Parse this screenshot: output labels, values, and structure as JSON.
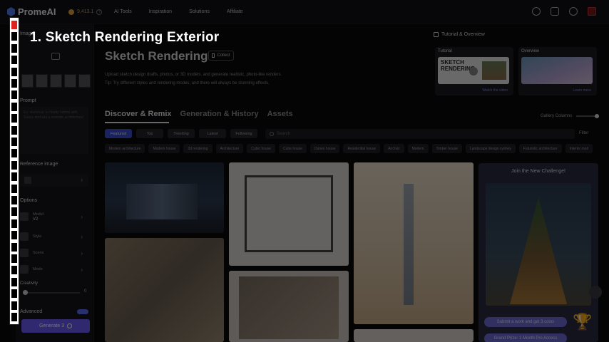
{
  "overlay": {
    "caption": "1. Sketch Rendering Exterior"
  },
  "nav": {
    "logo": "PromeAI",
    "coins": "9,413.1",
    "links": [
      "AI Tools",
      "Inspiration",
      "Solutions",
      "Affiliate"
    ]
  },
  "left_panel": {
    "image_title": "Image",
    "prompt_title": "Prompt",
    "prompt_placeholder": "Ex: sketchup 'a cloudy harbor with Sanny and sea a seaside architecture'",
    "reference_title": "Reference image",
    "options_title": "Options",
    "model_label": "Model",
    "model_value": "V2",
    "style_label": "Style",
    "scene_label": "Scene",
    "mode_label": "Mode",
    "creativity_label": "Creativity",
    "creativity_value": "0",
    "advanced_label": "Advanced",
    "generate_label": "Generate 3"
  },
  "main": {
    "title": "Sketch Rendering",
    "collect_label": "Collect",
    "desc_line1": "Upload sketch design drafts, photos, or 3D models, and generate realistic, photo-like renders.",
    "desc_line2": "Tip: Try different styles and rendering modes, and there will always be stunning effects.",
    "tutorial_header": "Tutorial & Overview",
    "tutorial_card": {
      "title": "Tutorial",
      "thumb_text": "SKETCH RENDERING",
      "link": "Watch the video"
    },
    "overview_card": {
      "title": "Overview",
      "link": "Learn more"
    },
    "tabs": [
      "Discover & Remix",
      "Generation & History",
      "Assets"
    ],
    "gallery_columns_label": "Gallery Columns",
    "filters": [
      "Featured",
      "Top",
      "Trending",
      "Latest",
      "Following"
    ],
    "search_placeholder": "Search",
    "filter_label": "Filter",
    "chips": [
      "Modern architecture",
      "Modern house",
      "3d rendering",
      "Architecture",
      "Cubic house",
      "Cube house",
      "Dunes house",
      "Residential house",
      "Archviz",
      "Modern",
      "Timber house",
      "Landscape design sydney",
      "Futuristic architecture",
      "Interior mod"
    ],
    "challenge": {
      "title": "Join the New Challenge!",
      "btn1": "Submit a work and get 3 coins",
      "btn2": "Grand Prize: 1 Month Pro Access"
    }
  },
  "colors": {
    "accent": "#6a5cf5",
    "active_filter": "#3b4fd0",
    "step_active": "#dd2222"
  }
}
